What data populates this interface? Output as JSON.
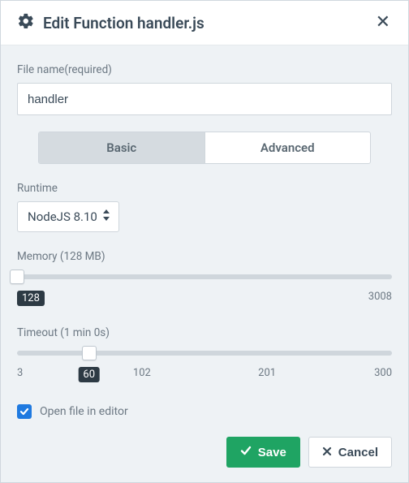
{
  "header": {
    "title": "Edit Function handler.js"
  },
  "filename": {
    "label": "File name(required)",
    "value": "handler"
  },
  "tabs": {
    "basic": "Basic",
    "advanced": "Advanced",
    "active": "basic"
  },
  "runtime": {
    "label": "Runtime",
    "selected": "NodeJS 8.10"
  },
  "memory": {
    "label": "Memory (128 MB)",
    "min": 128,
    "max": 3008,
    "value": 128,
    "min_display": "128",
    "max_display": "3008"
  },
  "timeout": {
    "label": "Timeout (1 min 0s)",
    "min": 3,
    "max": 300,
    "value": 60,
    "ticks": {
      "t0": "3",
      "t1": "60",
      "t2": "102",
      "t3": "201",
      "t4": "300"
    }
  },
  "open_in_editor": {
    "label": "Open file in editor",
    "checked": true
  },
  "footer": {
    "save": "Save",
    "cancel": "Cancel"
  },
  "colors": {
    "accent_blue": "#1f7ae0",
    "accent_green": "#1fa463",
    "body_bg": "#eef2f5",
    "border": "#cfd6dc",
    "badge": "#2d3a44"
  }
}
